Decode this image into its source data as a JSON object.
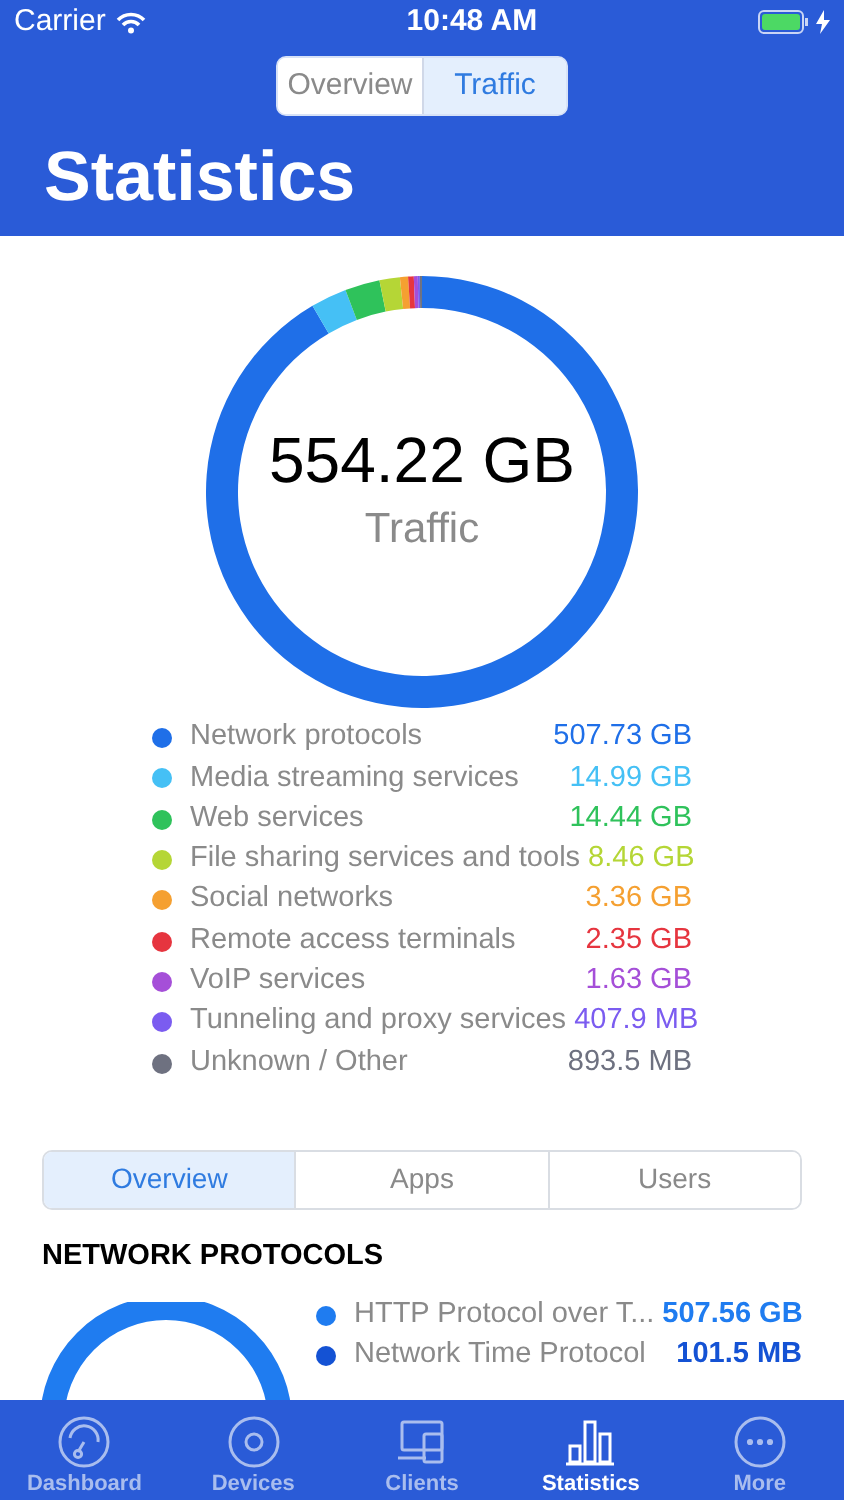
{
  "status_bar": {
    "carrier": "Carrier",
    "time": "10:48 AM"
  },
  "top_segments": [
    {
      "label": "Overview",
      "selected": false
    },
    {
      "label": "Traffic",
      "selected": true
    }
  ],
  "title": "Statistics",
  "total": {
    "value": "554.22 GB",
    "label": "Traffic",
    "chart_data": {
      "type": "donut",
      "series": [
        {
          "values": [
            91.606,
            2.704,
            2.605,
            1.526,
            0.606,
            0.424,
            0.294,
            0.074,
            0.161
          ]
        }
      ]
    }
  },
  "breakdown": [
    {
      "label": "Network protocols",
      "value": "507.73 GB",
      "color": "#1f6fe8"
    },
    {
      "label": "Media streaming services",
      "value": "14.99 GB",
      "color": "#45c0f5"
    },
    {
      "label": "Web services",
      "value": "14.44 GB",
      "color": "#2fc25b"
    },
    {
      "label": "File sharing services and tools",
      "value": "8.46 GB",
      "color": "#b5d636"
    },
    {
      "label": "Social networks",
      "value": "3.36 GB",
      "color": "#f5a031"
    },
    {
      "label": "Remote access terminals",
      "value": "2.35 GB",
      "color": "#e6353f"
    },
    {
      "label": "VoIP services",
      "value": "1.63 GB",
      "color": "#a54fd8"
    },
    {
      "label": "Tunneling and proxy services",
      "value": "407.9 MB",
      "color": "#7b5cf0"
    },
    {
      "label": "Unknown / Other",
      "value": "893.5 MB",
      "color": "#6e7180"
    }
  ],
  "section_tabs": [
    {
      "label": "Overview",
      "selected": true
    },
    {
      "label": "Apps",
      "selected": false
    },
    {
      "label": "Users",
      "selected": false
    }
  ],
  "section": {
    "heading": "NETWORK PROTOCOLS",
    "items": [
      {
        "label": "HTTP Protocol over T...",
        "value": "507.56 GB",
        "color": "#1f7cf0"
      },
      {
        "label": "Network Time Protocol",
        "value": "101.5 MB",
        "color": "#1452d4"
      }
    ]
  },
  "tab_bar": [
    {
      "label": "Dashboard",
      "kind": "gauge",
      "selected": false
    },
    {
      "label": "Devices",
      "kind": "disc",
      "selected": false
    },
    {
      "label": "Clients",
      "kind": "screens",
      "selected": false
    },
    {
      "label": "Statistics",
      "kind": "bars",
      "selected": true
    },
    {
      "label": "More",
      "kind": "dots",
      "selected": false
    }
  ]
}
